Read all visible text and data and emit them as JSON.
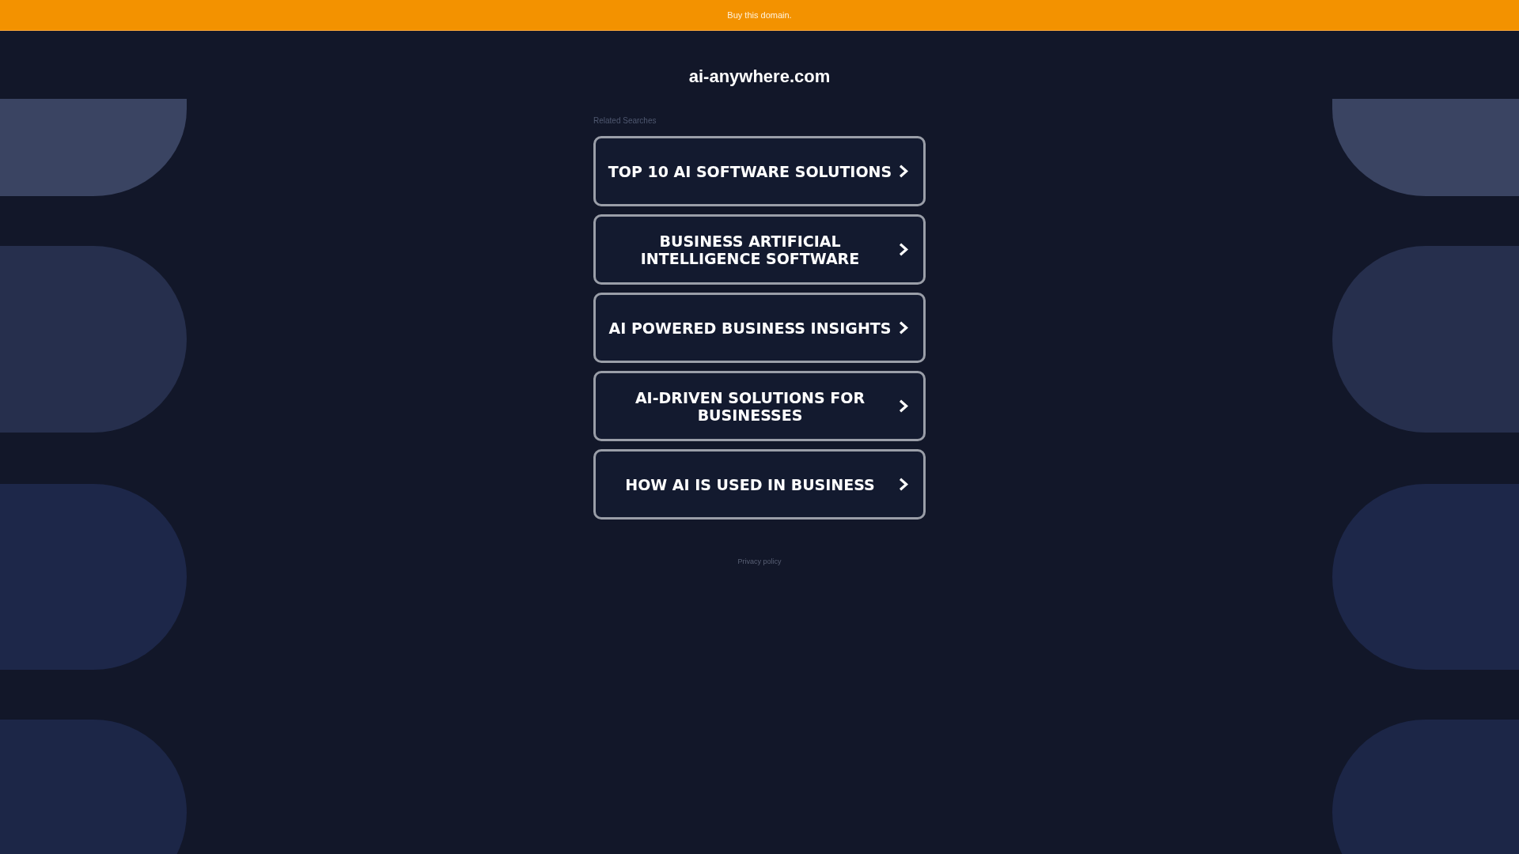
{
  "top_bar": {
    "link": "Buy this domain."
  },
  "domain_title": "ai-anywhere.com",
  "related_searches": {
    "heading": "Related Searches",
    "items": [
      "TOP 10 AI SOFTWARE SOLUTIONS",
      "BUSINESS ARTIFICIAL INTELLIGENCE SOFTWARE",
      "AI POWERED BUSINESS INSIGHTS",
      "AI-DRIVEN SOLUTIONS FOR BUSINESSES",
      "HOW AI IS USED IN BUSINESS"
    ]
  },
  "footer": {
    "privacy_link": "Privacy policy"
  }
}
